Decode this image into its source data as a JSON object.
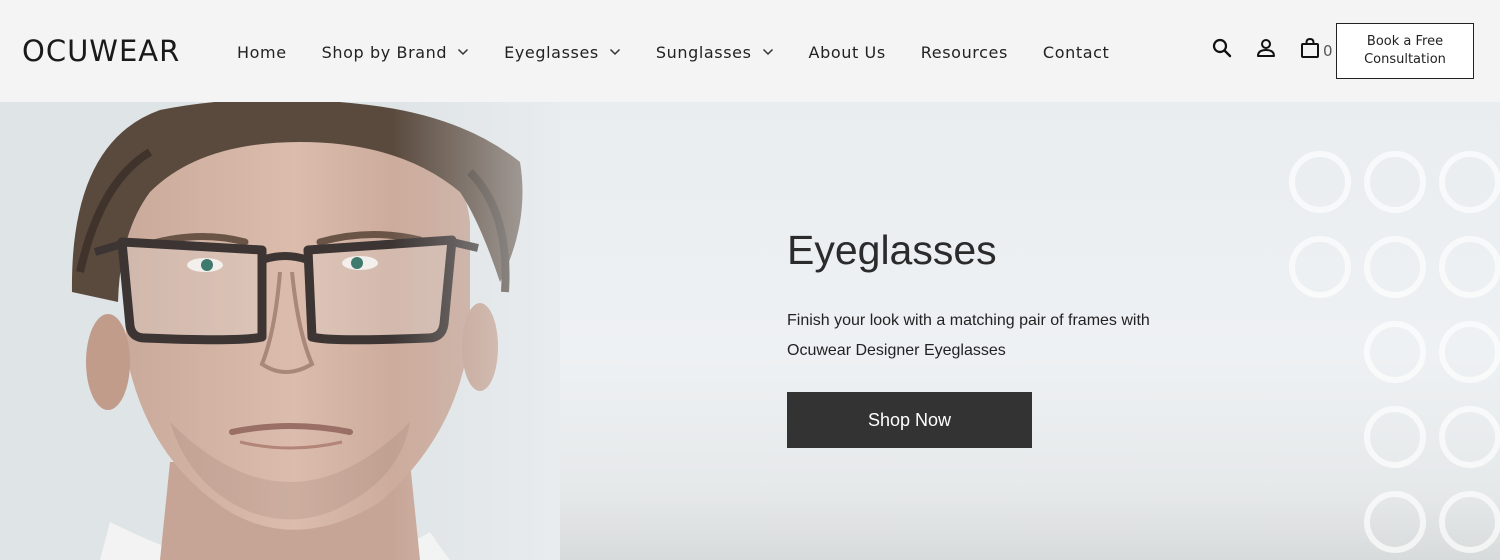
{
  "brand": {
    "logo_text": "OCUWEAR"
  },
  "nav": {
    "items": [
      {
        "label": "Home",
        "has_dropdown": false
      },
      {
        "label": "Shop by Brand",
        "has_dropdown": true
      },
      {
        "label": "Eyeglasses",
        "has_dropdown": true
      },
      {
        "label": "Sunglasses",
        "has_dropdown": true
      },
      {
        "label": "About Us",
        "has_dropdown": false
      },
      {
        "label": "Resources",
        "has_dropdown": false
      },
      {
        "label": "Contact",
        "has_dropdown": false
      }
    ]
  },
  "header_icons": {
    "search": "search-icon",
    "account": "user-icon",
    "cart": "shopping-bag-icon",
    "cart_count": "0"
  },
  "cta": {
    "consult_label": "Book a Free Consultation"
  },
  "hero": {
    "title": "Eyeglasses",
    "description": "Finish your look with a matching pair of frames with Ocuwear Designer Eyeglasses",
    "button_label": "Shop Now",
    "image": "man-wearing-dark-rectangular-eyeglasses"
  },
  "colors": {
    "header_bg": "#f4f4f4",
    "button_bg": "#333333",
    "text": "#222222"
  }
}
